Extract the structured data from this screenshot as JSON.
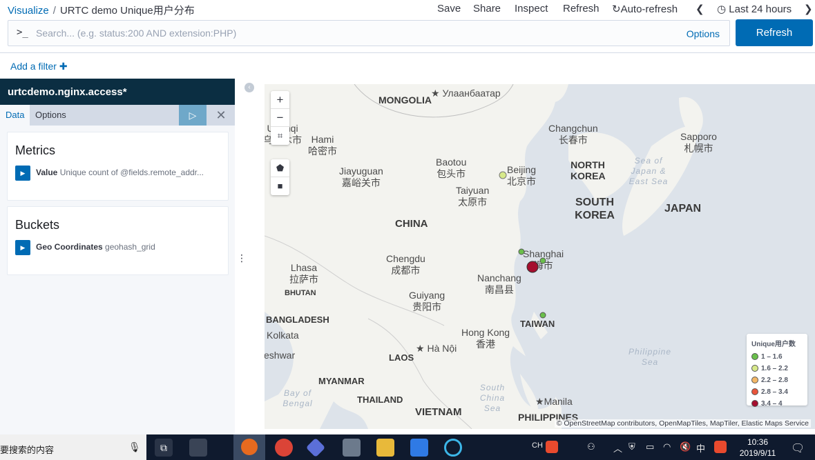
{
  "breadcrumb": {
    "root": "Visualize",
    "separator": "/",
    "title": "URTC demo Unique用户分布"
  },
  "top_menu": {
    "save": "Save",
    "share": "Share",
    "inspect": "Inspect",
    "refresh": "Refresh",
    "auto_refresh": "Auto-refresh",
    "time_range": "Last 24 hours"
  },
  "query": {
    "prompt": ">_",
    "placeholder": "Search... (e.g. status:200 AND extension:PHP)",
    "options": "Options",
    "refresh_button": "Refresh"
  },
  "filters": {
    "add_filter": "Add a filter"
  },
  "sidebar": {
    "index_pattern": "urtcdemo.nginx.access*",
    "tabs": [
      "Data",
      "Options"
    ],
    "metrics": {
      "title": "Metrics",
      "label": "Value",
      "description": "Unique count of @fields.remote_addr..."
    },
    "buckets": {
      "title": "Buckets",
      "label": "Geo Coordinates",
      "description": "geohash_grid"
    }
  },
  "map": {
    "controls": [
      "+",
      "−"
    ],
    "labels": {
      "mongolia": "MONGOLIA",
      "ulaanbaatar": "Улаанбаатар",
      "urumqi": "Urumqi",
      "urumqi_cn": "乌鲁木市",
      "hami": "Hami",
      "hami_cn": "哈密市",
      "jiayuguan": "Jiayuguan",
      "jiayuguan_cn": "嘉峪关市",
      "baotou": "Baotou",
      "baotou_cn": "包头市",
      "beijing": "Beijing",
      "beijing_cn": "北京市",
      "taiyuan": "Taiyuan",
      "taiyuan_cn": "太原市",
      "changchun": "Changchun",
      "changchun_cn": "长春市",
      "sapporo": "Sapporo",
      "sapporo_cn": "札幌市",
      "north_korea": "NORTH KOREA",
      "south_korea": "SOUTH KOREA",
      "japan": "JAPAN",
      "sea_of_japan": "Sea of Japan & East Sea",
      "china": "CHINA",
      "chengdu": "Chengdu",
      "chengdu_cn": "成都市",
      "shanghai": "Shanghai",
      "shanghai_cn": "海市",
      "lhasa": "Lhasa",
      "lhasa_cn": "拉萨市",
      "bhutan": "BHUTAN",
      "nanchang": "Nanchang",
      "nanchang_cn": "南昌县",
      "guiyang": "Guiyang",
      "guiyang_cn": "贵阳市",
      "bangladesh": "BANGLADESH",
      "taiwan": "TAIWAN",
      "kolkata": "Kolkata",
      "hong_kong": "Hong Kong",
      "hong_kong_cn": "香港",
      "ha_noi": "Hà Nội",
      "philippine_sea": "Philippine Sea",
      "laos": "LAOS",
      "eshwar": "eshwar",
      "myanmar": "MYANMAR",
      "bay_of_bengal": "Bay of Bengal",
      "thailand": "THAILAND",
      "south_china_sea": "South China Sea",
      "manila": "Manila",
      "vietnam": "VIETNAM",
      "philippines": "PHILIPPINES"
    },
    "attribution": "© OpenStreetMap contributors, OpenMapTiles, MapTiler, Elastic Maps Service"
  },
  "legend": {
    "title": "Unique用户数",
    "ranges": [
      {
        "label": "1 – 1.6",
        "color": "#6abf4b"
      },
      {
        "label": "1.6 – 2.2",
        "color": "#d7e98a"
      },
      {
        "label": "2.2 – 2.8",
        "color": "#f3b868"
      },
      {
        "label": "2.8 – 3.4",
        "color": "#e8553b"
      },
      {
        "label": "3.4 – 4",
        "color": "#a50e2e"
      }
    ]
  },
  "taskbar": {
    "search_text": "要搜索的内容",
    "ime": "中",
    "time": "10:36",
    "date": "2019/9/11"
  }
}
